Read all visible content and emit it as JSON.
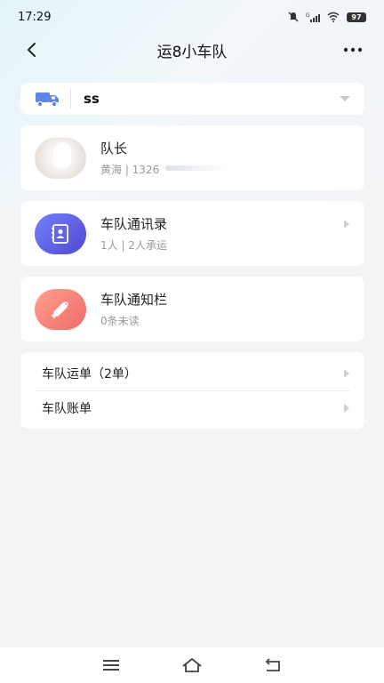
{
  "status_bar": {
    "time": "17:29",
    "battery": "97"
  },
  "nav": {
    "title": "运8小车队"
  },
  "team_selector": {
    "name": "ss"
  },
  "leader": {
    "role": "队长",
    "info": "黄海 | 1326"
  },
  "contacts": {
    "title": "车队通讯录",
    "sub": "1人 | 2人承运"
  },
  "notices": {
    "title": "车队通知栏",
    "sub": "0条未读"
  },
  "menu": [
    {
      "label": "车队运单（2单）"
    },
    {
      "label": "车队账单"
    }
  ],
  "colors": {
    "contacts_icon_gradient": [
      "#6f7ff6",
      "#5a52d8"
    ],
    "notices_icon_gradient": [
      "#ff9a8b",
      "#f2706a"
    ],
    "truck_icon": "#5f86e8"
  }
}
